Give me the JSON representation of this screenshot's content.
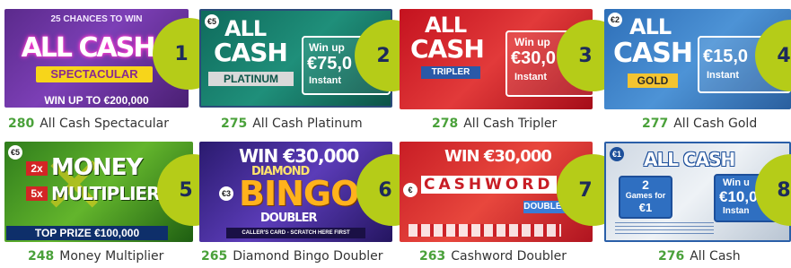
{
  "cards": [
    {
      "rank": "1",
      "count": "280",
      "name": "All Cash Spectacular",
      "ticket": {
        "top": "25 CHANCES TO WIN",
        "title": "ALL CASH",
        "sub": "SPECTACULAR",
        "bottom": "WIN UP TO €200,000"
      }
    },
    {
      "rank": "2",
      "count": "275",
      "name": "All Cash Platinum",
      "ticket": {
        "price": "€5",
        "title1": "ALL",
        "title2": "CASH",
        "sub": "PLATINUM",
        "box": "Win up",
        "amount": "€75,0",
        "instant": "Instant"
      }
    },
    {
      "rank": "3",
      "count": "278",
      "name": "All Cash Tripler",
      "ticket": {
        "title1": "ALL",
        "title2": "CASH",
        "sub": "TRIPLER",
        "box": "Win up",
        "amount": "€30,0",
        "instant": "Instant"
      }
    },
    {
      "rank": "4",
      "count": "277",
      "name": "All Cash Gold",
      "ticket": {
        "price": "€2",
        "title1": "ALL",
        "title2": "CASH",
        "sub": "GOLD",
        "amount": "€15,0",
        "instant": "Instant"
      }
    },
    {
      "rank": "5",
      "count": "248",
      "name": "Money Multiplier",
      "ticket": {
        "price": "€5",
        "line1": "2x",
        "word1": "MONEY",
        "line2": "5x",
        "word2": "MULTIPLIER",
        "prize": "TOP PRIZE €100,000"
      }
    },
    {
      "rank": "6",
      "count": "265",
      "name": "Diamond Bingo Doubler",
      "ticket": {
        "price": "€3",
        "top": "WIN €30,000",
        "title1": "DIAMOND",
        "title2": "BINGO",
        "sub": "DOUBLER",
        "strip": "CALLER'S CARD - SCRATCH HERE FIRST"
      }
    },
    {
      "rank": "7",
      "count": "263",
      "name": "Cashword Doubler",
      "ticket": {
        "price": "€",
        "top": "WIN €30,000",
        "title": "CASHWORD",
        "sub": "DOUBLER"
      }
    },
    {
      "rank": "8",
      "count": "276",
      "name": "All Cash",
      "ticket": {
        "price": "€1",
        "title": "ALL CASH",
        "games": "2",
        "games_label": "Games for",
        "games_price": "€1",
        "box": "Win u",
        "amount": "€10,0",
        "instant": "Instan"
      }
    }
  ],
  "colors": {
    "rank_circle": "#b5cc18",
    "rank_text": "#1d2b5a",
    "count": "#4aa13a"
  }
}
